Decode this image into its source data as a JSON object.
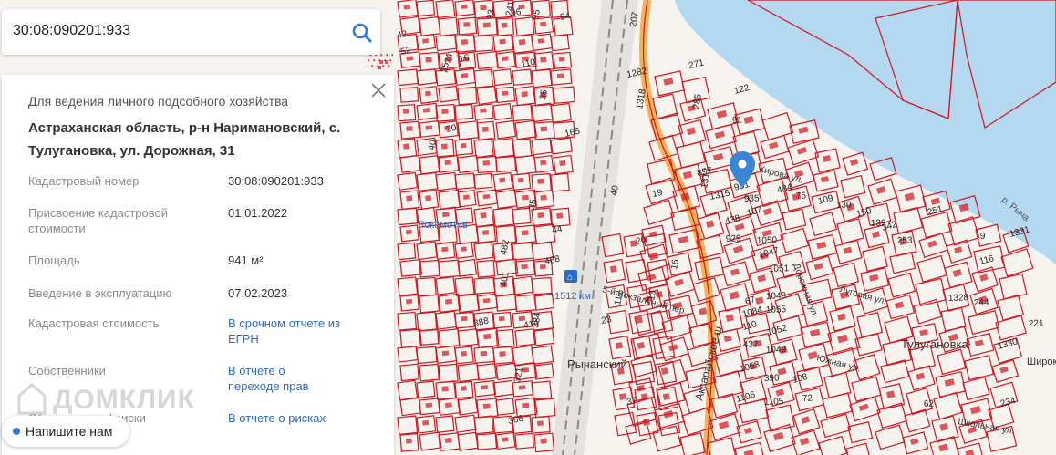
{
  "search": {
    "value": "30:08:090201:933"
  },
  "card": {
    "purpose": "Для ведения личного подсобного хозяйства",
    "address": "Астраханская область, р-н Наримановский, с. Тулугановка, ул. Дорожная, 31",
    "rows": [
      {
        "label": "Кадастровый номер",
        "value": "30:08:090201:933"
      },
      {
        "label": "Присвоение кадастровой стоимости",
        "value": "01.01.2022"
      },
      {
        "label": "Площадь",
        "value": "941 м²"
      },
      {
        "label": "Введение в эксплуатацию",
        "value": "07.02.2023"
      },
      {
        "label": "Кадастровая стоимость",
        "value": "В срочном отчете из ЕГРН"
      },
      {
        "label": "Собственники",
        "value": "В отчете о переходе прав"
      },
      {
        "label": "Обременения / риски",
        "value": "В отчете о рисках"
      }
    ]
  },
  "chat": {
    "label": "Напишите нам"
  },
  "watermark": "ДОМКЛИК",
  "map": {
    "settlements": [
      "Тулугановка",
      "Рычанский"
    ],
    "streets": [
      "Аксарайское ш.",
      "5-й Вокзальный пер.",
      "Дорожная ул.",
      "Луговая ул.",
      "Южная ул.",
      "Школьная ул.",
      "Кирова ул.",
      "Локомотив",
      "Широкая"
    ],
    "river": "р. Рыча",
    "station": "1512 км",
    "parcel_numbers": [
      "96",
      "95",
      "94",
      "93",
      "42",
      "42/1",
      "52",
      "24",
      "16",
      "25",
      "110",
      "36",
      "165",
      "40",
      "20",
      "35",
      "44",
      "482",
      "488",
      "401",
      "414",
      "384",
      "388",
      "321",
      "366",
      "13",
      "23",
      "112",
      "20",
      "16",
      "19",
      "40",
      "37",
      "207",
      "1282",
      "1318",
      "271",
      "122",
      "91",
      "285",
      "857",
      "1313",
      "1315",
      "931",
      "935",
      "438",
      "929",
      "107",
      "1050",
      "1047",
      "1051",
      "67",
      "1048",
      "1084",
      "1055",
      "110",
      "437",
      "1052",
      "1049",
      "1053",
      "390",
      "1106",
      "1105",
      "108",
      "72",
      "484",
      "76",
      "109",
      "130",
      "150",
      "139",
      "342",
      "253",
      "251",
      "9",
      "1331",
      "1328",
      "116",
      "244",
      "1330",
      "62",
      "234",
      "221",
      "241"
    ],
    "colors": {
      "background": "#f7f3ef",
      "parcel": "#d0161f",
      "river": "#b3d8ef",
      "highway": "#f2b45a",
      "marker": "#3a86d6"
    }
  }
}
